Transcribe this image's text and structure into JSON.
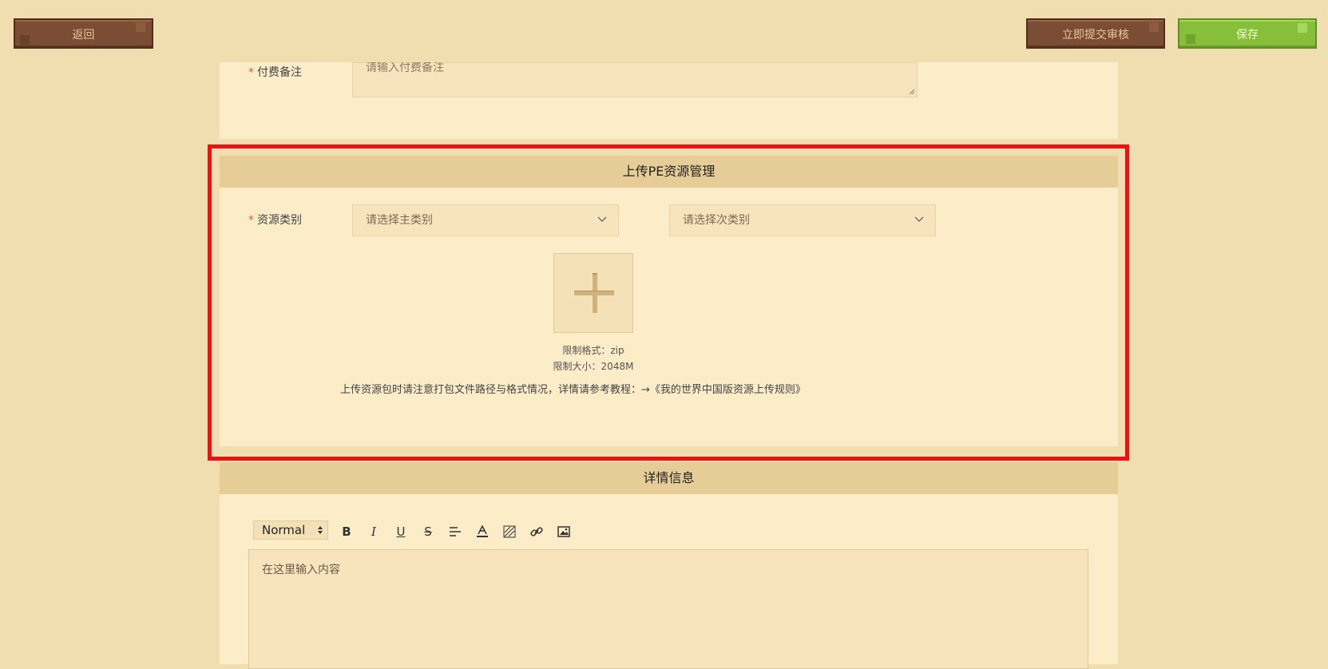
{
  "header": {
    "back_label": "返回",
    "submit_label": "立即提交审核",
    "save_label": "保存"
  },
  "payment": {
    "label": "付费备注",
    "placeholder": "请输入付费备注"
  },
  "upload_section": {
    "title": "上传PE资源管理",
    "category_label": "资源类别",
    "main_select_placeholder": "请选择主类别",
    "sub_select_placeholder": "请选择次类别",
    "format_limit": "限制格式：zip",
    "size_limit": "限制大小：2048M",
    "notice": "上传资源包时请注意打包文件路径与格式情况，详情请参考教程：→《我的世界中国版资源上传规则》"
  },
  "details_section": {
    "title": "详情信息",
    "format_option": "Normal",
    "editor_placeholder": "在这里输入内容",
    "toolbar_icons": [
      "bold-icon",
      "italic-icon",
      "underline-icon",
      "strike-icon",
      "align-icon",
      "font-color-icon",
      "background-color-icon",
      "link-icon",
      "image-icon"
    ]
  },
  "colors": {
    "page_bg": "#f0ddb0",
    "panel_bg": "#fdecc8",
    "panel_head": "#e6cd98",
    "brown_button": "#7a4d34",
    "green_button": "#86c03a",
    "highlight": "#ee1111"
  }
}
